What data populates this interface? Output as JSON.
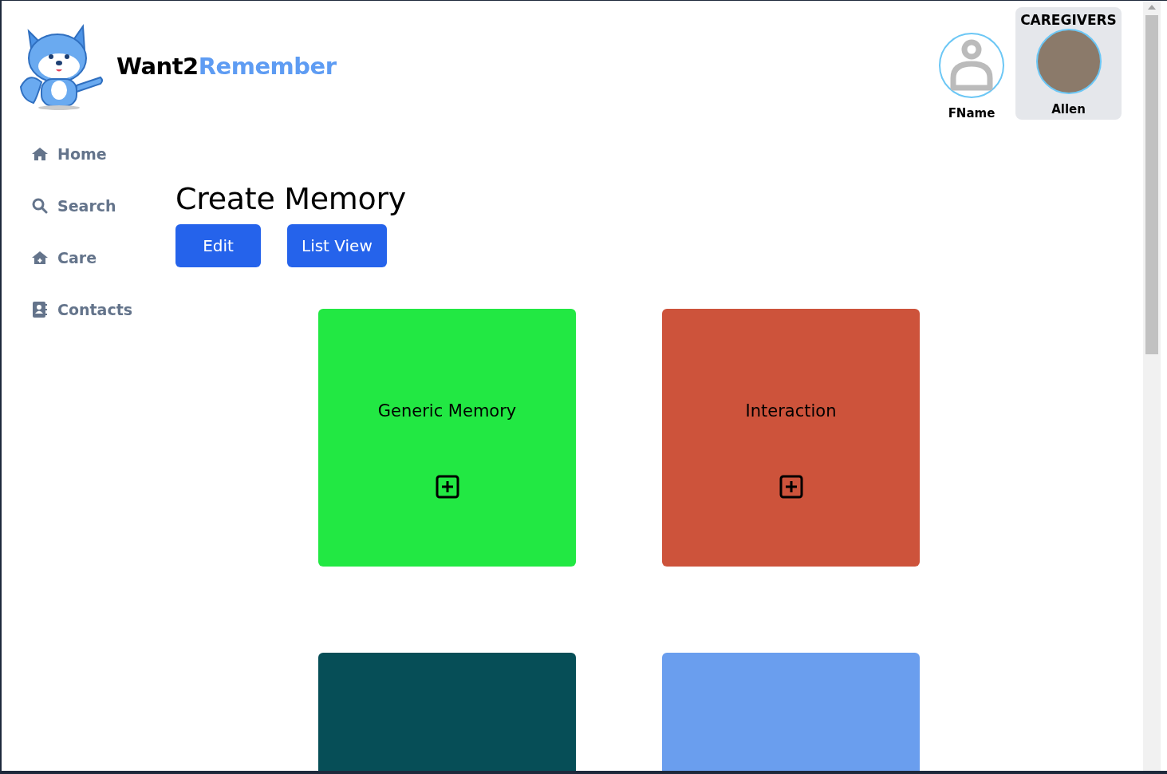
{
  "brand": {
    "name_part_1": "Want2",
    "name_part_2": "Remember"
  },
  "profile": {
    "name": "FName"
  },
  "caregivers": {
    "title": "CAREGIVERS",
    "people": [
      {
        "name": "Allen"
      }
    ]
  },
  "sidebar": {
    "items": [
      {
        "label": "Home",
        "kind": "home"
      },
      {
        "label": "Search",
        "kind": "search"
      },
      {
        "label": "Care",
        "kind": "care"
      },
      {
        "label": "Contacts",
        "kind": "contacts"
      }
    ]
  },
  "page": {
    "title": "Create Memory",
    "buttons": [
      "Edit",
      "List View"
    ]
  },
  "cards": [
    {
      "label": "Generic Memory",
      "color": "#22e843"
    },
    {
      "label": "Interaction",
      "color": "#cd533b"
    },
    {
      "color": "#064e57"
    },
    {
      "color": "#6a9eee"
    }
  ]
}
